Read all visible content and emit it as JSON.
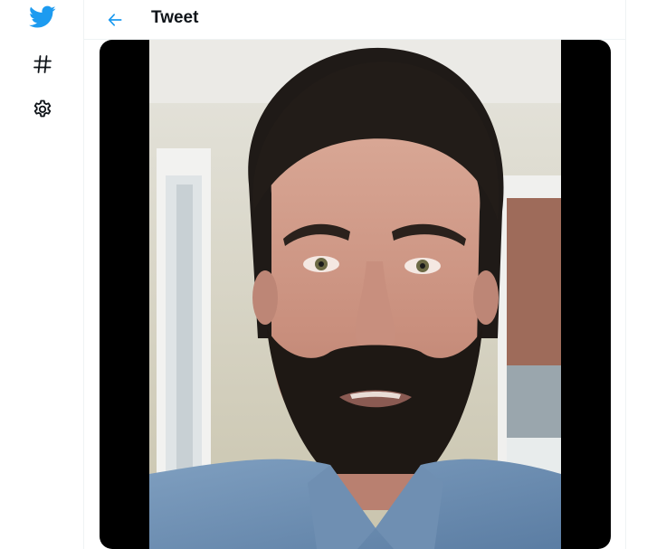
{
  "nav": {
    "items": [
      {
        "name": "twitter-logo",
        "icon": "twitter-bird-icon"
      },
      {
        "name": "explore",
        "icon": "hashtag-icon"
      },
      {
        "name": "settings",
        "icon": "gear-icon"
      }
    ]
  },
  "header": {
    "title": "Tweet",
    "back_icon": "arrow-left-icon"
  },
  "colors": {
    "brand_blue": "#1d9bf0",
    "text_primary": "#0f1419",
    "border": "#eff3f4"
  }
}
